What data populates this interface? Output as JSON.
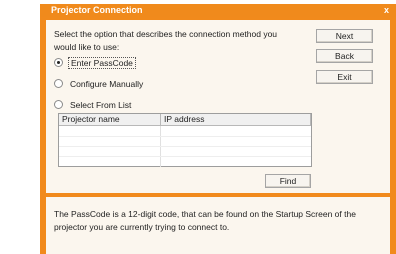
{
  "window": {
    "title": "Projector Connection",
    "close_glyph": "x"
  },
  "instructions": "Select the option that describes the connection method you would like to use:",
  "options": [
    {
      "label": "Enter PassCode",
      "selected": true
    },
    {
      "label": "Configure Manually",
      "selected": false
    },
    {
      "label": "Select From List",
      "selected": false
    }
  ],
  "buttons": {
    "next": "Next",
    "back": "Back",
    "exit": "Exit",
    "find": "Find"
  },
  "projector_list": {
    "columns": [
      "Projector name",
      "IP address"
    ],
    "rows": []
  },
  "help_text": "The PassCode is a 12-digit code, that can be found on the Startup Screen of the projector you are currently trying to connect to.",
  "colors": {
    "accent": "#f18a1c",
    "panel": "#fbf6ee"
  }
}
